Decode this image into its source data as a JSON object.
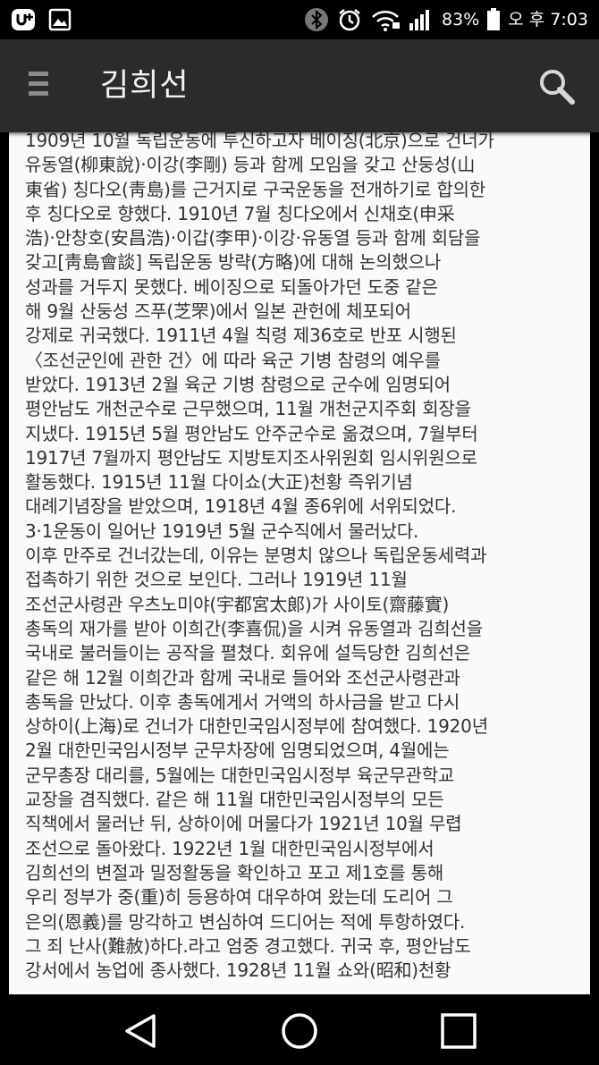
{
  "status_bar": {
    "left_icons": [
      "u-plus-icon",
      "gallery-icon"
    ],
    "right_icons": [
      "bluetooth-icon",
      "alarm-icon",
      "wifi-icon",
      "signal-icon",
      "battery-icon"
    ],
    "battery_percent": "83%",
    "time": "오 후 7:03"
  },
  "app_bar": {
    "title": "김희선",
    "menu_icon": "menu-icon",
    "search_icon": "search-icon"
  },
  "content": {
    "lines": [
      "1909년 10월 독립운동에 투신하고자 베이징(北京)으로 건너가",
      "유동열(柳東說)·이강(李剛) 등과 함께 모임을 갖고 산둥성(山",
      "東省) 칭다오(靑島)를 근거지로 구국운동을 전개하기로 합의한",
      "후 칭다오로 향했다. 1910년 7월 칭다오에서 신채호(申采",
      "浩)·안창호(安昌浩)·이갑(李甲)·이강·유동열 등과 함께 회담을",
      "갖고[靑島會談] 독립운동 방략(方略)에 대해 논의했으나",
      "성과를 거두지 못했다. 베이징으로 되돌아가던 도중 같은",
      "해 9월 산둥성 즈푸(芝罘)에서 일본 관헌에 체포되어",
      "강제로 귀국했다. 1911년 4월 칙령 제36호로 반포 시행된",
      "〈조선군인에 관한 건〉에 따라 육군 기병 참령의 예우를",
      "받았다. 1913년 2월 육군 기병 참령으로 군수에 임명되어",
      "평안남도 개천군수로 근무했으며, 11월 개천군지주회 회장을",
      "지냈다. 1915년 5월 평안남도 안주군수로 옮겼으며, 7월부터",
      "1917년 7월까지 평안남도 지방토지조사위원회 임시위원으로",
      "활동했다. 1915년 11월 다이쇼(大正)천황 즉위기념",
      "대례기념장을 받았으며, 1918년 4월 종6위에 서위되었다.",
      "3·1운동이 일어난 1919년 5월 군수직에서 물러났다.",
      "이후 만주로 건너갔는데, 이유는 분명치 않으나 독립운동세력과",
      "접촉하기 위한 것으로 보인다. 그러나 1919년 11월",
      "조선군사령관 우츠노미야(宇都宮太郞)가 사이토(齋藤實)",
      "총독의 재가를 받아 이희간(李喜侃)을 시켜 유동열과 김희선을",
      "국내로 불러들이는 공작을 펼쳤다. 회유에 설득당한 김희선은",
      "같은 해 12월 이희간과 함께 국내로 들어와 조선군사령관과",
      "총독을 만났다. 이후 총독에게서 거액의 하사금을 받고 다시",
      "상하이(上海)로 건너가 대한민국임시정부에 참여했다. 1920년",
      "2월 대한민국임시정부 군무차장에 임명되었으며, 4월에는",
      "군무총장 대리를, 5월에는 대한민국임시정부 육군무관학교",
      "교장을 겸직했다. 같은 해 11월 대한민국임시정부의 모든",
      "직책에서 물러난 뒤, 상하이에 머물다가 1921년 10월 무렵",
      "조선으로 돌아왔다. 1922년 1월 대한민국임시정부에서",
      "김희선의 변절과 밀정활동을 확인하고 포고 제1호를 통해",
      "우리 정부가 중(重)히 등용하여 대우하여 왔는데 도리어 그",
      "은의(恩義)를 망각하고 변심하여 드디어는 적에 투항하였다.",
      "그 죄 난사(難赦)하다.라고 엄중 경고했다. 귀국 후, 평안남도",
      "강서에서 농업에 종사했다. 1928년 11월 쇼와(昭和)천황"
    ]
  },
  "nav_bar": {
    "back_icon": "back-triangle-icon",
    "home_icon": "home-circle-icon",
    "recents_icon": "recents-square-icon"
  }
}
